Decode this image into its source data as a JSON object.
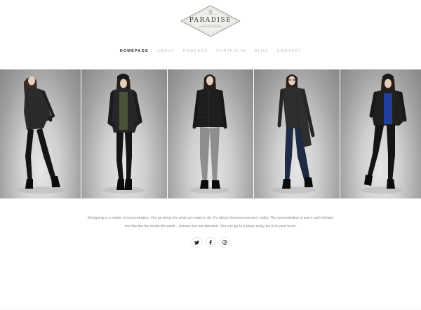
{
  "brand": {
    "title": "PARADISE",
    "tagline": "CREATIVE STUDIO"
  },
  "nav": {
    "items": [
      {
        "label": "HOMEPAGE",
        "active": true
      },
      {
        "label": "ABOUT",
        "active": false
      },
      {
        "label": "PROCESS",
        "active": false
      },
      {
        "label": "PORTFOLIO",
        "active": false
      },
      {
        "label": "BLOG",
        "active": false
      },
      {
        "label": "CONTACT",
        "active": false
      }
    ]
  },
  "gallery": {
    "images": [
      {
        "name": "model-1",
        "outfit": "dark quilted jacket, black pants, long brown hair"
      },
      {
        "name": "model-2",
        "outfit": "black leather jacket, olive top, beanie"
      },
      {
        "name": "model-3",
        "outfit": "black quilted jacket, grey trousers"
      },
      {
        "name": "model-4",
        "outfit": "long charcoal coat, navy jeans, glasses"
      },
      {
        "name": "model-5",
        "outfit": "black jacket, blue top, beanie"
      }
    ]
  },
  "quote": {
    "line1": "Designing is a matter of concentration. You go deep into what you want to do. It's about intensive research really. The concentration is warm and intimate",
    "line2": "and like the fire inside the earth – intense but not distorted. You can go to a place really feel it in your heart."
  },
  "social": {
    "items": [
      {
        "name": "twitter",
        "icon": "twitter-icon"
      },
      {
        "name": "facebook",
        "icon": "facebook-icon"
      },
      {
        "name": "pinterest",
        "icon": "pinterest-icon"
      }
    ]
  },
  "colors": {
    "text_dark": "#2a2a2a",
    "text_muted": "#bdbdbd",
    "body_text": "#8c8c8c",
    "backdrop": "#cfcfcf"
  }
}
